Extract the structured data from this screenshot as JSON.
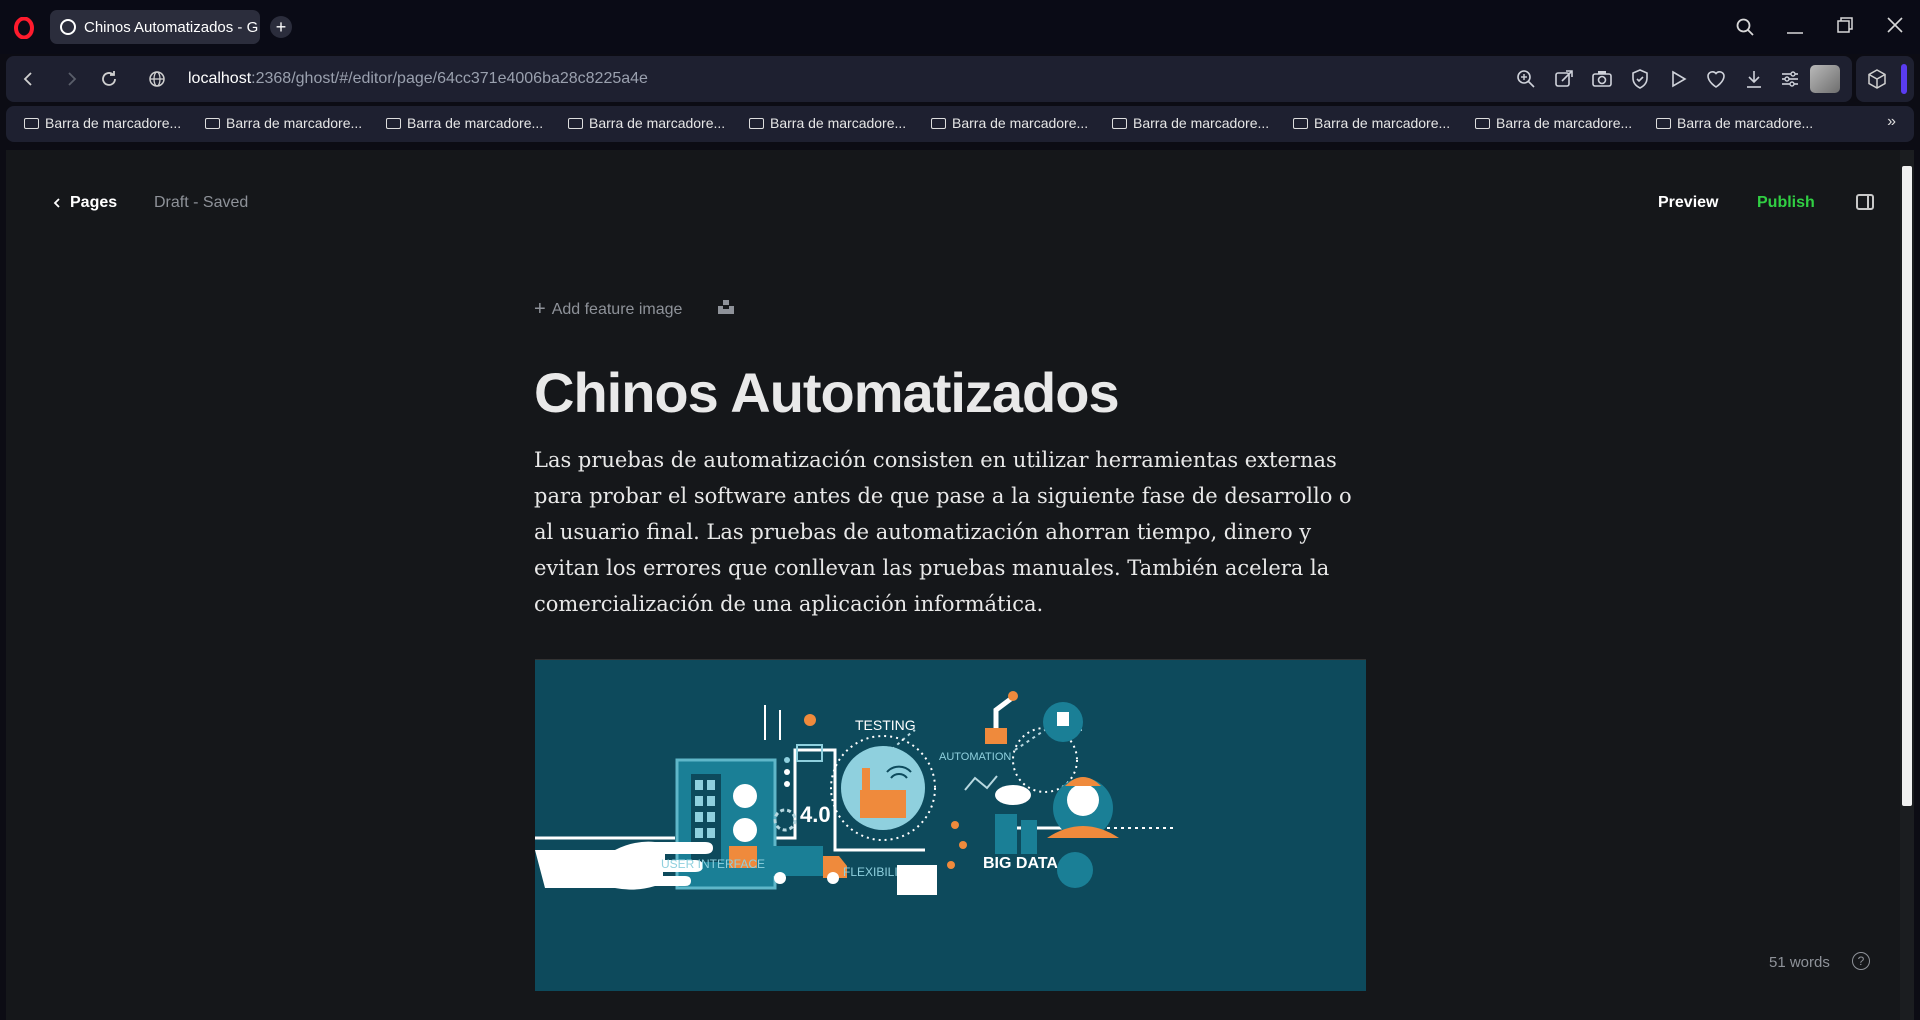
{
  "browser": {
    "tab_title": "Chinos Automatizados - G",
    "new_tab_symbol": "+",
    "url_host": "localhost",
    "url_path": ":2368/ghost/#/editor/page/64cc371e4006ba28c8225a4e",
    "bookmarks": [
      "Barra de marcadore...",
      "Barra de marcadore...",
      "Barra de marcadore...",
      "Barra de marcadore...",
      "Barra de marcadore...",
      "Barra de marcadore...",
      "Barra de marcadore...",
      "Barra de marcadore...",
      "Barra de marcadore...",
      "Barra de marcadore..."
    ],
    "icons": [
      "opera-logo",
      "search-icon",
      "minimize-icon",
      "restore-icon",
      "close-icon",
      "back-icon",
      "forward-icon",
      "reload-icon",
      "globe-icon",
      "zoom-icon",
      "share-icon",
      "camera-icon",
      "shield-icon",
      "play-icon",
      "heart-icon",
      "download-icon",
      "settings-icon",
      "avatar",
      "cube-icon"
    ]
  },
  "editor": {
    "back_label": "Pages",
    "status": "Draft - Saved",
    "preview_label": "Preview",
    "publish_label": "Publish",
    "add_feature_image": "Add feature image",
    "title": "Chinos Automatizados",
    "body": "Las pruebas de automatización consisten en utilizar herramientas externas para probar el software antes de que pase a la siguiente fase de desarrollo o al usuario final. Las pruebas de automatización ahorran tiempo, dinero y evitan los errores que conllevan las pruebas manuales. También acelera la comercialización de una aplicación informática.",
    "word_count": "51 words",
    "help_symbol": "?",
    "publish_color": "#30cf43"
  },
  "image": {
    "testing": "TESTING",
    "automation": "AUTOMATION",
    "industry": "4.0",
    "user_interface": "USER INTERFACE",
    "flexibility": "FLEXIBILITY",
    "big_data": "BIG DATA",
    "background_color": "#0d4a5c",
    "accent_color": "#ef8a3c"
  }
}
